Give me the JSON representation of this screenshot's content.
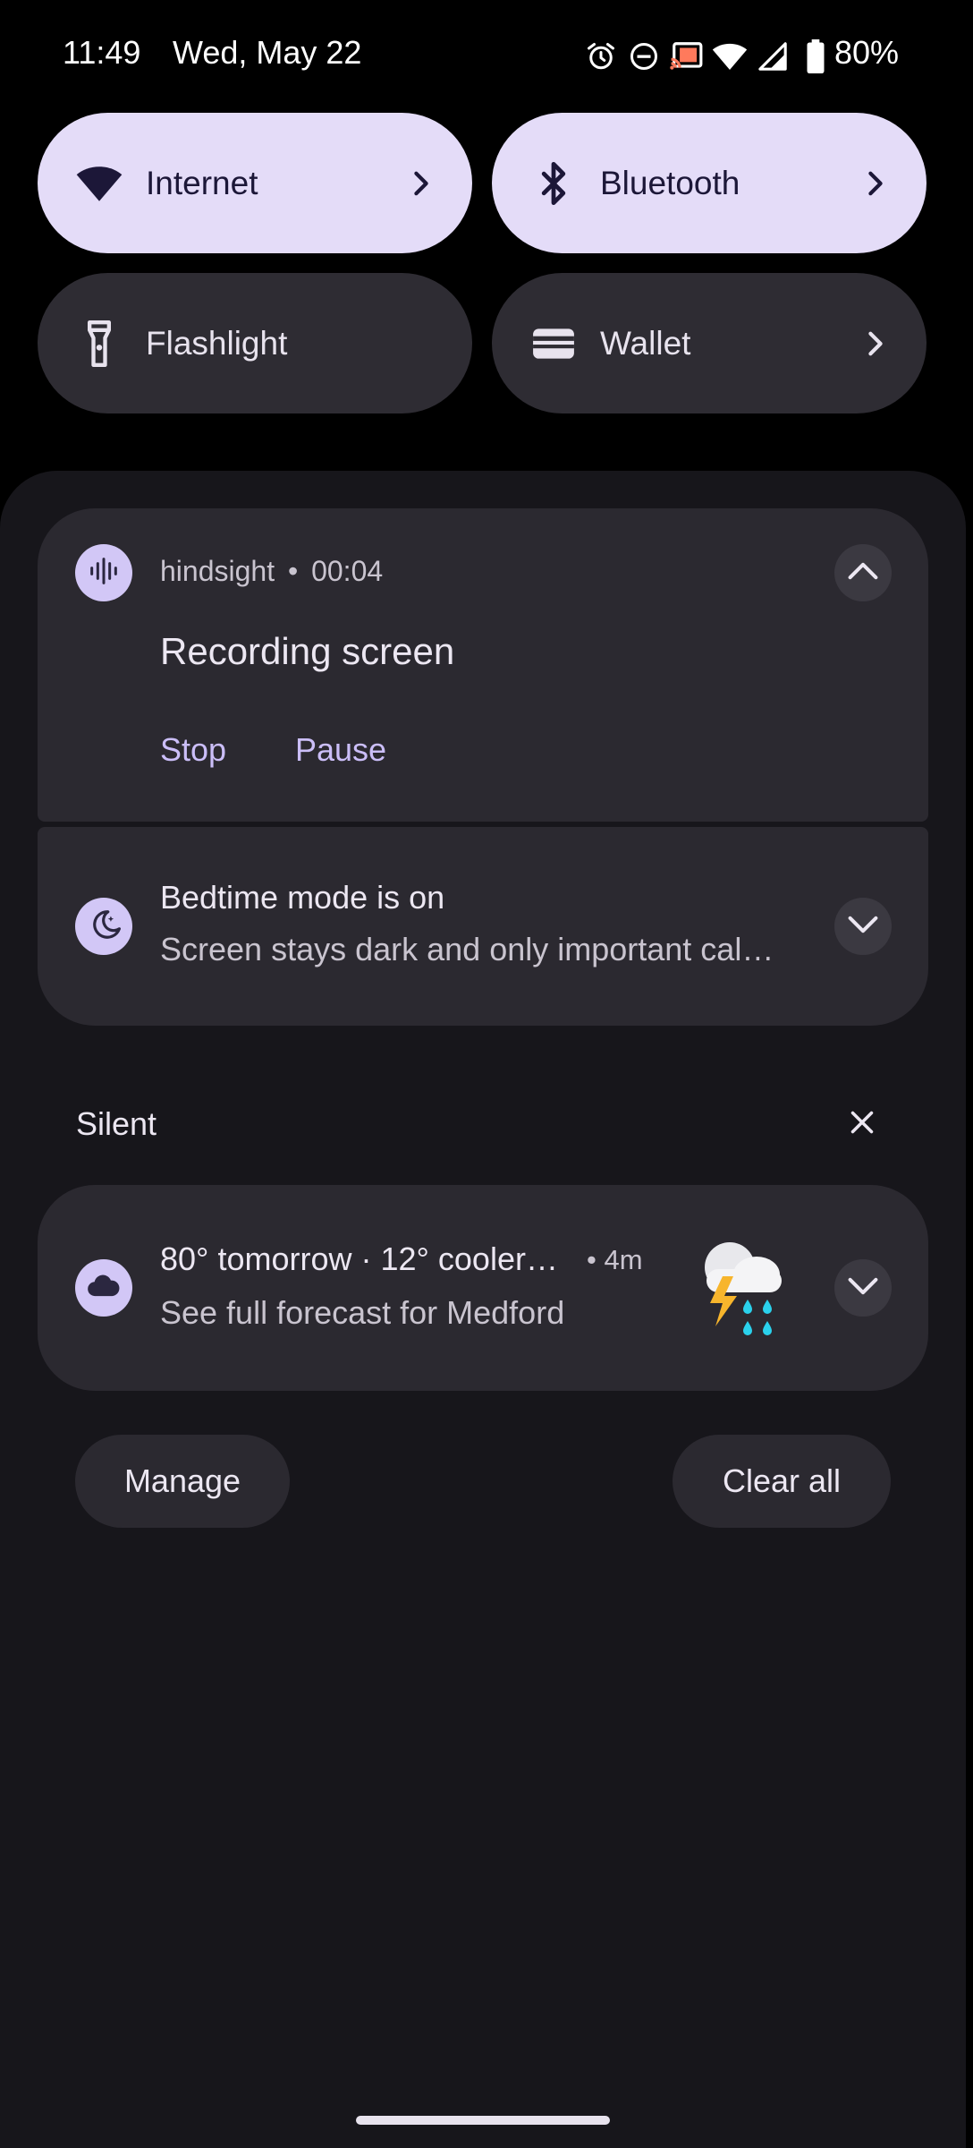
{
  "status_bar": {
    "time": "11:49",
    "date": "Wed, May 22",
    "battery": "80%",
    "icons": [
      "alarm-icon",
      "do-not-disturb-icon",
      "cast-icon",
      "wifi-icon",
      "cellular-signal-icon",
      "battery-icon"
    ]
  },
  "quick_settings": {
    "tiles": [
      {
        "label": "Internet",
        "icon": "wifi-icon",
        "active": true
      },
      {
        "label": "Bluetooth",
        "icon": "bluetooth-icon",
        "active": true
      },
      {
        "label": "Flashlight",
        "icon": "flashlight-icon",
        "active": false
      },
      {
        "label": "Wallet",
        "icon": "wallet-icon",
        "active": false
      }
    ]
  },
  "notifications": {
    "recording": {
      "app": "hindsight",
      "separator": "•",
      "elapsed": "00:04",
      "title": "Recording screen",
      "actions": [
        "Stop",
        "Pause"
      ]
    },
    "bedtime": {
      "title": "Bedtime mode is on",
      "text": "Screen stays dark and only important cal…"
    },
    "silent_section": {
      "label": "Silent"
    },
    "weather": {
      "title": "80° tomorrow · 12° cooler…",
      "time": "• 4m",
      "text": "See full forecast for Medford",
      "image": "thunderstorm-rain-icon"
    }
  },
  "footer": {
    "manage_label": "Manage",
    "clear_all_label": "Clear all"
  },
  "colors": {
    "active_tile": "#e4dcf8",
    "inactive_tile": "#2e2c33",
    "card": "#2b2930",
    "accent_text": "#cbbef8",
    "shade": "#17161b"
  }
}
